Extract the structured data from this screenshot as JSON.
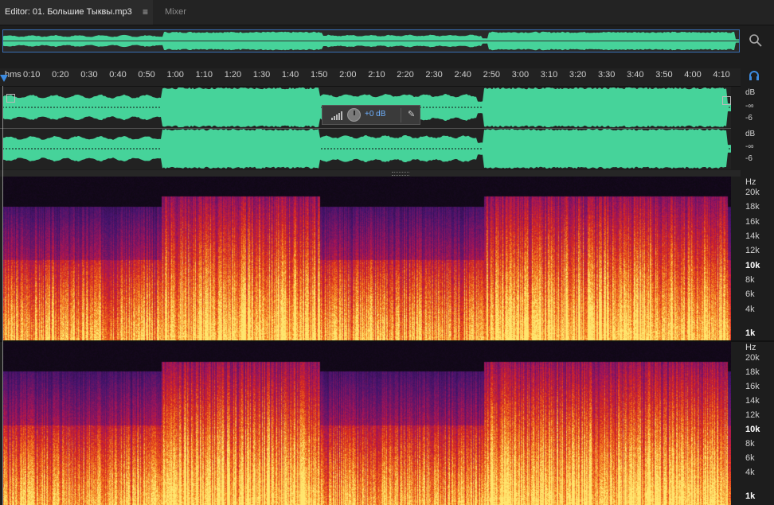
{
  "tabs": {
    "editor_label": "Editor: 01. Большие Тыквы.mp3",
    "menu_glyph": "≡",
    "mixer_label": "Mixer"
  },
  "ruler": {
    "unit_label": "hms",
    "ticks": [
      "0:10",
      "0:20",
      "0:30",
      "0:40",
      "0:50",
      "1:00",
      "1:10",
      "1:20",
      "1:30",
      "1:40",
      "1:50",
      "2:00",
      "2:10",
      "2:20",
      "2:30",
      "2:40",
      "2:50",
      "3:00",
      "3:10",
      "3:20",
      "3:30",
      "3:40",
      "3:50",
      "4:00",
      "4:10"
    ]
  },
  "hud": {
    "gain_value": "+0 dB",
    "pin_glyph": "✎"
  },
  "channel_scale": {
    "top": {
      "db": "dB",
      "inf": "-∞",
      "minus6": "-6"
    },
    "bottom": {
      "db": "dB",
      "inf": "-∞",
      "minus6": "-6"
    }
  },
  "spectral_scale": {
    "unit": "Hz",
    "labels": [
      "20k",
      "18k",
      "16k",
      "14k",
      "12k",
      "10k",
      "8k",
      "6k",
      "4k",
      "1k"
    ]
  },
  "icons": {
    "zoom": "magnifier-icon",
    "headphones": "headphones-icon",
    "menu": "menu-icon"
  },
  "colors": {
    "waveform": "#46d39a",
    "selection_border": "#3a6fb4",
    "playhead": "#3d8be0",
    "hud_text": "#6fb1ff"
  }
}
